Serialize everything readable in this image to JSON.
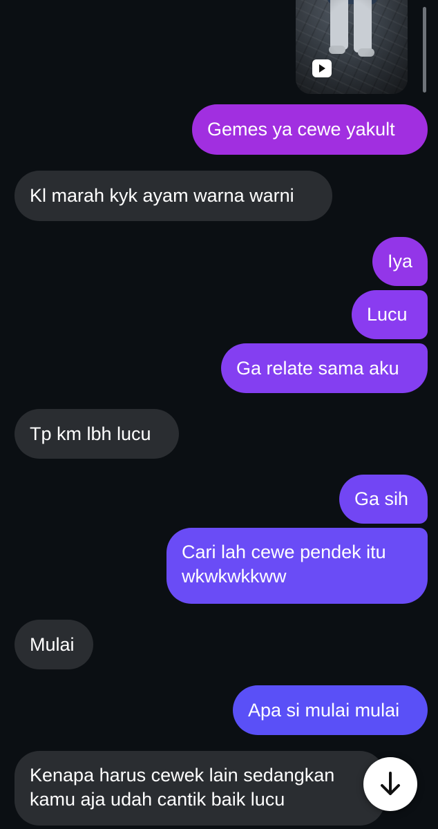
{
  "colors": {
    "background": "#0b0f13",
    "incoming_bubble": "#2a2d31",
    "outgoing_gradient": [
      "#a12fe0",
      "#8a3cf0",
      "#6a4cf6",
      "#5a50f7"
    ],
    "text": "#ffffff"
  },
  "media": {
    "type": "video",
    "icon": "play-icon"
  },
  "messages": [
    {
      "side": "out",
      "text": "Gemes ya cewe yakult"
    },
    {
      "side": "in",
      "text": "Kl marah kyk ayam warna warni"
    },
    {
      "side": "out",
      "text": "Iya"
    },
    {
      "side": "out",
      "text": "Lucu"
    },
    {
      "side": "out",
      "text": "Ga relate sama aku"
    },
    {
      "side": "in",
      "text": "Tp km lbh lucu"
    },
    {
      "side": "out",
      "text": "Ga sih"
    },
    {
      "side": "out",
      "text": "Cari lah cewe pendek itu wkwkwkkww"
    },
    {
      "side": "in",
      "text": "Mulai"
    },
    {
      "side": "out",
      "text": "Apa si mulai mulai"
    },
    {
      "side": "in",
      "text": "Kenapa harus cewek lain sedangkan kamu aja udah cantik baik lucu"
    }
  ],
  "scroll_down_button": {
    "icon": "arrow-down-icon"
  }
}
